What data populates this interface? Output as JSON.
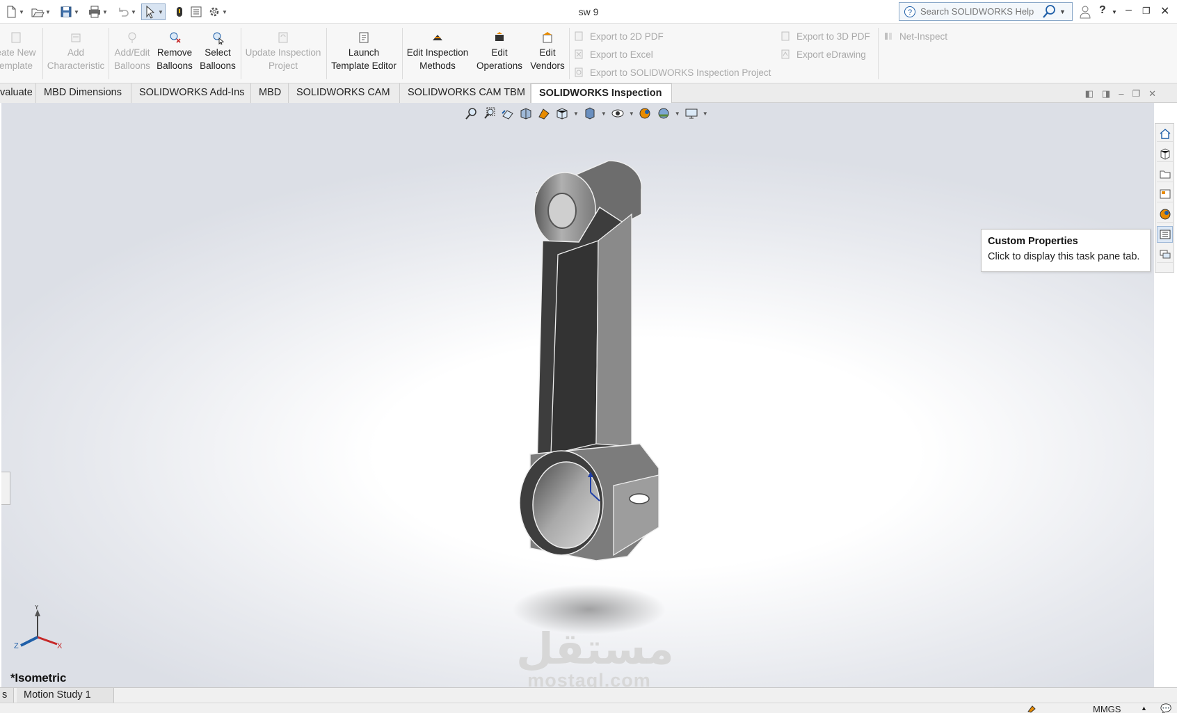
{
  "app": {
    "document_title": "sw 9"
  },
  "search": {
    "placeholder": "Search SOLIDWORKS Help"
  },
  "colors": {
    "accent": "#1f5fa8",
    "disabled_text": "#a9a9a9",
    "part_dark": "#3a3a3a",
    "part_light": "#9a9a9a",
    "tooltip_border": "#c4c4c4"
  },
  "quick_access": [
    "new-document-icon",
    "open-icon",
    "save-icon",
    "print-icon",
    "undo-icon",
    "select-icon",
    "rebuild-icon",
    "file-properties-icon",
    "options-icon"
  ],
  "ribbon": {
    "create_template": {
      "line1": "eate New",
      "line2": "emplate"
    },
    "add_characteristic": {
      "line1": "Add",
      "line2": "Characteristic"
    },
    "add_edit_balloons": {
      "line1": "Add/Edit",
      "line2": "Balloons"
    },
    "remove_balloons": {
      "line1": "Remove",
      "line2": "Balloons"
    },
    "select_balloons": {
      "line1": "Select",
      "line2": "Balloons"
    },
    "update_project": {
      "line1": "Update Inspection",
      "line2": "Project"
    },
    "launch_template_editor": {
      "line1": "Launch",
      "line2": "Template Editor"
    },
    "edit_methods": {
      "line1": "Edit Inspection",
      "line2": "Methods"
    },
    "edit_operations": {
      "line1": "Edit",
      "line2": "Operations"
    },
    "edit_vendors": {
      "line1": "Edit",
      "line2": "Vendors"
    },
    "export_2d_pdf": "Export to 2D PDF",
    "export_excel": "Export to Excel",
    "export_sw_project": "Export to SOLIDWORKS Inspection Project",
    "export_3d_pdf": "Export to 3D PDF",
    "export_edrawing": "Export eDrawing",
    "net_inspect": "Net-Inspect"
  },
  "tabs": [
    {
      "label": "valuate"
    },
    {
      "label": "MBD Dimensions"
    },
    {
      "label": "SOLIDWORKS Add-Ins"
    },
    {
      "label": "MBD"
    },
    {
      "label": "SOLIDWORKS CAM"
    },
    {
      "label": "SOLIDWORKS CAM TBM"
    },
    {
      "label": "SOLIDWORKS Inspection",
      "active": true
    }
  ],
  "heads_up_toolbar": [
    "zoom-to-fit-icon",
    "zoom-to-area-icon",
    "previous-view-icon",
    "section-view-icon",
    "dynamic-annotation-icon",
    "view-orientation-icon",
    "display-style-icon",
    "hide-show-items-icon",
    "edit-appearance-icon",
    "apply-scene-icon",
    "view-settings-icon"
  ],
  "task_pane": {
    "tabs": [
      "solidworks-resources-icon",
      "design-library-icon",
      "file-explorer-icon",
      "view-palette-icon",
      "appearances-icon",
      "custom-properties-icon",
      "forum-icon"
    ],
    "tooltip_title": "Custom Properties",
    "tooltip_text": "Click to display this task pane tab."
  },
  "view": {
    "name": "*Isometric"
  },
  "triad": {
    "x": "X",
    "y": "Y",
    "z": "Z"
  },
  "bottom_tabs": [
    {
      "label": "s"
    },
    {
      "label": "Motion Study 1"
    }
  ],
  "status": {
    "units": "MMGS"
  },
  "watermark": {
    "arabic": "مستقل",
    "latin": "mostaql.com"
  }
}
